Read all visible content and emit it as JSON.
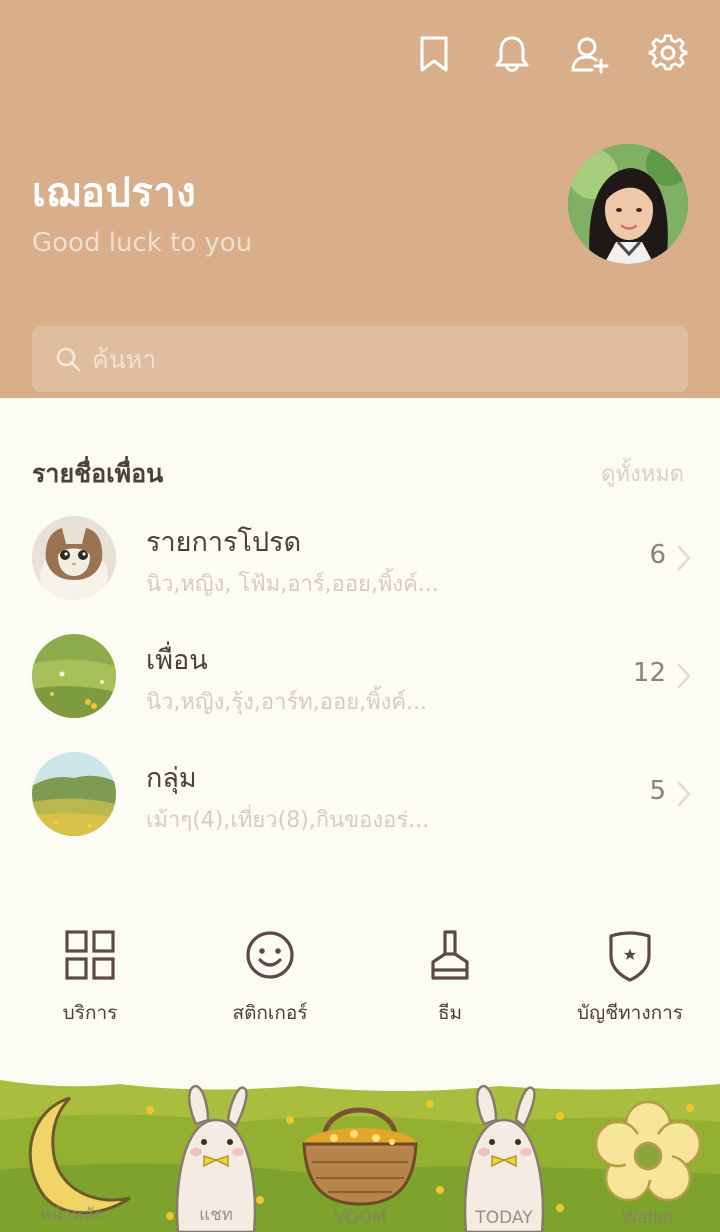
{
  "header": {
    "profile_name": "เฌอปราง",
    "status_message": "Good luck to you",
    "icons": [
      "bookmark-icon",
      "bell-icon",
      "add-friend-icon",
      "gear-icon"
    ],
    "background_color": "#d8ae8b"
  },
  "search": {
    "placeholder": "ค้นหา"
  },
  "friends": {
    "title": "รายชื่อเพื่อน",
    "see_all": "ดูทั้งหมด",
    "rows": [
      {
        "title": "รายการโปรด",
        "subtitle": "นิว,หญิง, โฟ้ม,อาร์,ออย,พิ้งค์...",
        "count": "6"
      },
      {
        "title": "เพื่อน",
        "subtitle": "นิว,หญิง,รุ้ง,อาร์ท,ออย,พิ้งค์...",
        "count": "12"
      },
      {
        "title": "กลุ่ม",
        "subtitle": "เม้าๆ(4),เที่ยว(8),กินของอร่...",
        "count": "5"
      }
    ]
  },
  "quick_menu": {
    "items": [
      {
        "label": "บริการ",
        "icon": "grid-icon"
      },
      {
        "label": "สติกเกอร์",
        "icon": "smiley-icon"
      },
      {
        "label": "ธีม",
        "icon": "brush-icon"
      },
      {
        "label": "บัญชีทางการ",
        "icon": "shield-star-icon"
      }
    ]
  },
  "bottom_nav": {
    "items": [
      {
        "label": "หน้าหลัก",
        "icon": "moon-icon"
      },
      {
        "label": "แชท",
        "icon": "bunny-icon"
      },
      {
        "label": "VOOM",
        "icon": "basket-icon"
      },
      {
        "label": "TODAY",
        "icon": "bunny-icon"
      },
      {
        "label": "Wallet",
        "icon": "flower-icon"
      }
    ]
  }
}
